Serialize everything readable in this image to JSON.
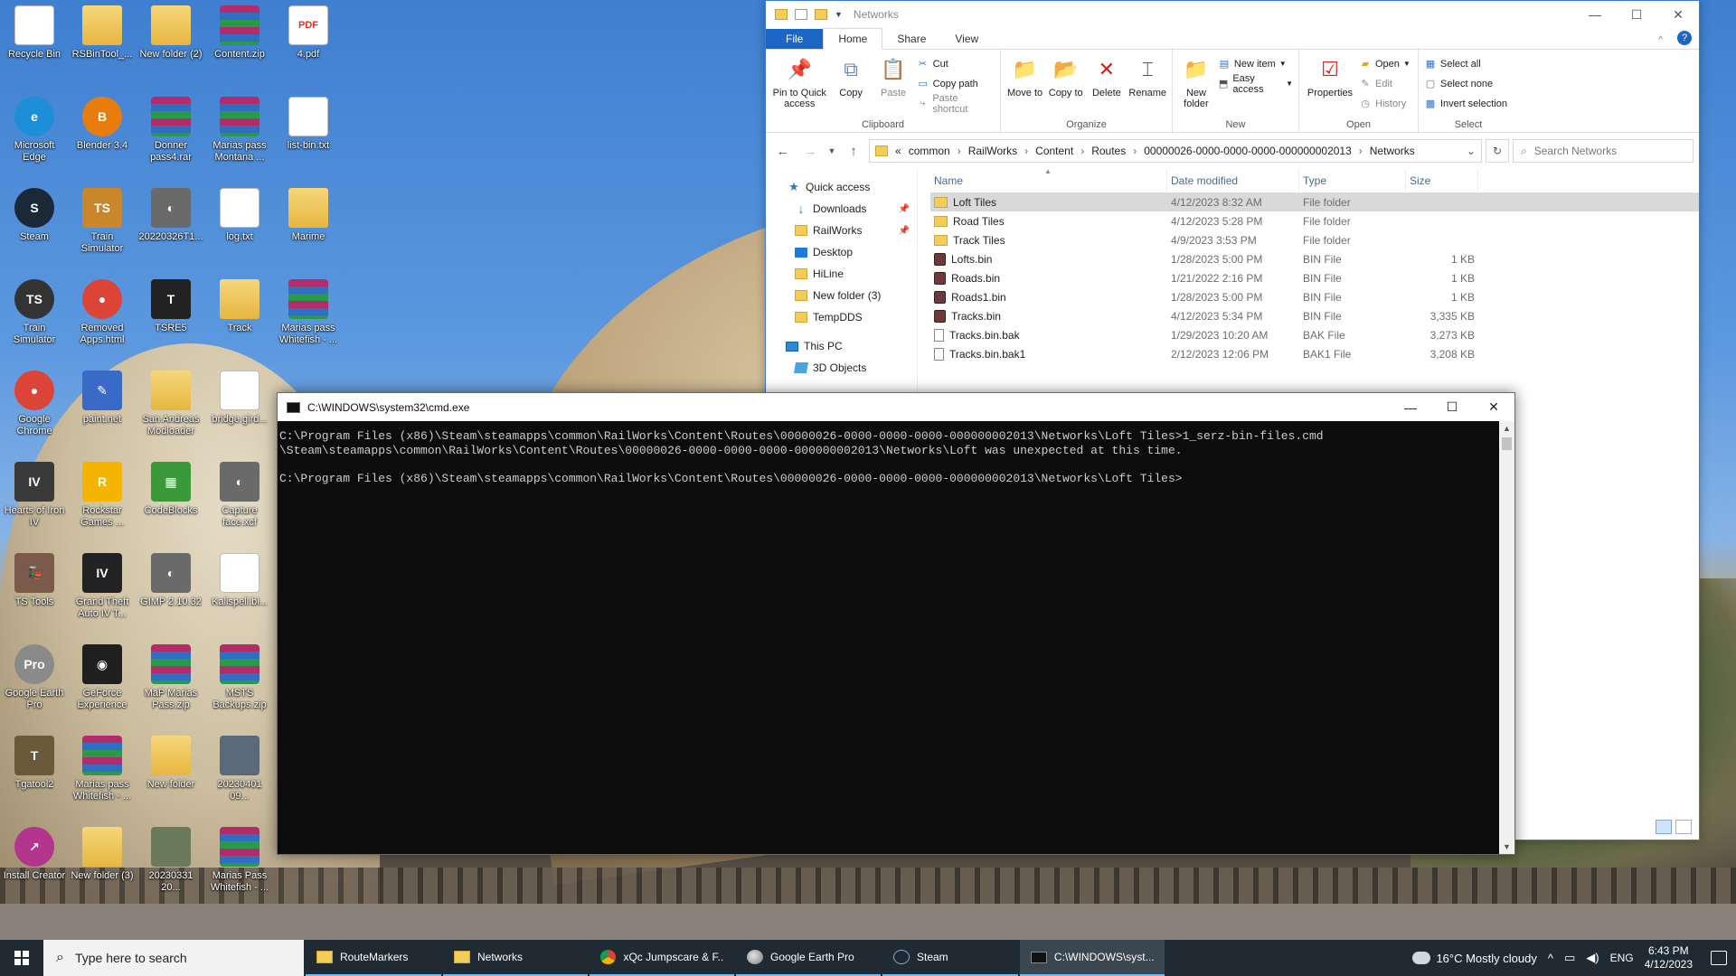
{
  "desktop": {
    "icons": [
      {
        "label": "Recycle Bin",
        "kind": "file",
        "glyph": "♻"
      },
      {
        "label": "Microsoft Edge",
        "kind": "round",
        "color": "#1d8fd8",
        "glyph": "e"
      },
      {
        "label": "Steam",
        "kind": "round",
        "color": "#1b2838",
        "glyph": "S"
      },
      {
        "label": "Train Simulator",
        "kind": "round",
        "color": "#333333",
        "glyph": "TS"
      },
      {
        "label": "Google Chrome",
        "kind": "round",
        "color": "#db4437",
        "glyph": "●"
      },
      {
        "label": "Hearts of Iron IV",
        "kind": "plain",
        "color": "#3a3a3a",
        "glyph": "IV"
      },
      {
        "label": "TS Tools",
        "kind": "plain",
        "color": "#7a5a4a",
        "glyph": "🚂"
      },
      {
        "label": "Google Earth Pro",
        "kind": "round",
        "color": "#8a8a8a",
        "glyph": "Pro"
      },
      {
        "label": "Tgatool2",
        "kind": "plain",
        "color": "#6a5a3a",
        "glyph": "T"
      },
      {
        "label": "Install Creator",
        "kind": "round",
        "color": "#b4358c",
        "glyph": "↗"
      },
      {
        "label": "RSBinTool_...",
        "kind": "folder",
        "glyph": ""
      },
      {
        "label": "Blender 3.4",
        "kind": "round",
        "color": "#e87d0d",
        "glyph": "B"
      },
      {
        "label": "Train Simulator",
        "kind": "plain",
        "color": "#c9862a",
        "glyph": "TS"
      },
      {
        "label": "Removed Apps.html",
        "kind": "round",
        "color": "#db4437",
        "glyph": "●"
      },
      {
        "label": "paint.net",
        "kind": "plain",
        "color": "#3a6ac8",
        "glyph": "✎"
      },
      {
        "label": "Rockstar Games ...",
        "kind": "plain",
        "color": "#f4b400",
        "glyph": "R"
      },
      {
        "label": "Grand Theft Auto IV T...",
        "kind": "plain",
        "color": "#222222",
        "glyph": "IV"
      },
      {
        "label": "GeForce Experience",
        "kind": "plain",
        "color": "#1f1f1f",
        "glyph": "◉"
      },
      {
        "label": "Marias pass Whitefish - ...",
        "kind": "rar",
        "glyph": ""
      },
      {
        "label": "New folder (3)",
        "kind": "folder",
        "glyph": ""
      },
      {
        "label": "New folder (2)",
        "kind": "folder",
        "glyph": ""
      },
      {
        "label": "Donner pass4.rar",
        "kind": "rar",
        "glyph": ""
      },
      {
        "label": "20220326T1...",
        "kind": "plain",
        "color": "#6a6a6a",
        "glyph": "◐"
      },
      {
        "label": "TSRE5",
        "kind": "plain",
        "color": "#222222",
        "glyph": "T"
      },
      {
        "label": "San Andreas Modloader",
        "kind": "folder",
        "glyph": ""
      },
      {
        "label": "CodeBlocks",
        "kind": "plain",
        "color": "#3a9a3a",
        "glyph": "▦"
      },
      {
        "label": "GIMP 2.10.32",
        "kind": "plain",
        "color": "#6a6a6a",
        "glyph": "◐"
      },
      {
        "label": "MaP Marias Pass.zip",
        "kind": "rar",
        "glyph": ""
      },
      {
        "label": "New folder",
        "kind": "folder",
        "glyph": ""
      },
      {
        "label": "20230331 20...",
        "kind": "plain",
        "color": "#6b7a5a",
        "glyph": ""
      },
      {
        "label": "Content.zip",
        "kind": "rar",
        "glyph": ""
      },
      {
        "label": "Marias pass Montana ...",
        "kind": "rar",
        "glyph": ""
      },
      {
        "label": "log.txt",
        "kind": "file",
        "glyph": ""
      },
      {
        "label": "Track",
        "kind": "folder",
        "glyph": ""
      },
      {
        "label": "bridge.gird...",
        "kind": "file",
        "glyph": ""
      },
      {
        "label": "Capture face.xcf",
        "kind": "plain",
        "color": "#6a6a6a",
        "glyph": "◐"
      },
      {
        "label": "Kalispell.bi...",
        "kind": "file",
        "glyph": ""
      },
      {
        "label": "MSTS Backups.zip",
        "kind": "rar",
        "glyph": ""
      },
      {
        "label": "20230401 09...",
        "kind": "plain",
        "color": "#5a6a7a",
        "glyph": ""
      },
      {
        "label": "Marias Pass Whitefish - ...",
        "kind": "rar",
        "glyph": ""
      },
      {
        "label": "4.pdf",
        "kind": "pdf",
        "glyph": "PDF"
      },
      {
        "label": "list-bin.txt",
        "kind": "file",
        "glyph": ""
      },
      {
        "label": "Marime",
        "kind": "folder",
        "glyph": ""
      },
      {
        "label": "Marias pass Whitefish - ...",
        "kind": "rar",
        "glyph": ""
      }
    ]
  },
  "explorer": {
    "title": "Networks",
    "tabs": [
      "File",
      "Home",
      "Share",
      "View"
    ],
    "ribbon": {
      "clipboard": {
        "name": "Clipboard",
        "pin": "Pin to Quick access",
        "copy": "Copy",
        "paste": "Paste",
        "cut": "Cut",
        "copy_path": "Copy path",
        "paste_shortcut": "Paste shortcut"
      },
      "organize": {
        "name": "Organize",
        "move_to": "Move to",
        "copy_to": "Copy to",
        "delete": "Delete",
        "rename": "Rename"
      },
      "new": {
        "name": "New",
        "new_folder": "New folder",
        "new_item": "New item",
        "easy_access": "Easy access"
      },
      "open": {
        "name": "Open",
        "properties": "Properties",
        "open": "Open",
        "edit": "Edit",
        "history": "History"
      },
      "select": {
        "name": "Select",
        "select_all": "Select all",
        "select_none": "Select none",
        "invert": "Invert selection"
      }
    },
    "address": [
      "«",
      "common",
      "RailWorks",
      "Content",
      "Routes",
      "00000026-0000-0000-0000-000000002013",
      "Networks"
    ],
    "search_placeholder": "Search Networks",
    "nav": {
      "quick_access": "Quick access",
      "downloads": "Downloads",
      "railworks": "RailWorks",
      "desktop": "Desktop",
      "hiline": "HiLine",
      "new_folder_3": "New folder (3)",
      "tempdds": "TempDDS",
      "this_pc": "This PC",
      "objects_3d": "3D Objects"
    },
    "columns": {
      "name": "Name",
      "date": "Date modified",
      "type": "Type",
      "size": "Size"
    },
    "files": [
      {
        "name": "Loft Tiles",
        "date": "4/12/2023 8:32 AM",
        "type": "File folder",
        "size": "",
        "icon": "folder"
      },
      {
        "name": "Road Tiles",
        "date": "4/12/2023 5:28 PM",
        "type": "File folder",
        "size": "",
        "icon": "folder"
      },
      {
        "name": "Track Tiles",
        "date": "4/9/2023 3:53 PM",
        "type": "File folder",
        "size": "",
        "icon": "folder"
      },
      {
        "name": "Lofts.bin",
        "date": "1/28/2023 5:00 PM",
        "type": "BIN File",
        "size": "1 KB",
        "icon": "bin"
      },
      {
        "name": "Roads.bin",
        "date": "1/21/2022 2:16 PM",
        "type": "BIN File",
        "size": "1 KB",
        "icon": "bin"
      },
      {
        "name": "Roads1.bin",
        "date": "1/28/2023 5:00 PM",
        "type": "BIN File",
        "size": "1 KB",
        "icon": "bin"
      },
      {
        "name": "Tracks.bin",
        "date": "4/12/2023 5:34 PM",
        "type": "BIN File",
        "size": "3,335 KB",
        "icon": "bin"
      },
      {
        "name": "Tracks.bin.bak",
        "date": "1/29/2023 10:20 AM",
        "type": "BAK File",
        "size": "3,273 KB",
        "icon": "bak"
      },
      {
        "name": "Tracks.bin.bak1",
        "date": "2/12/2023 12:06 PM",
        "type": "BAK1 File",
        "size": "3,208 KB",
        "icon": "bak"
      }
    ]
  },
  "cmd": {
    "title": "C:\\WINDOWS\\system32\\cmd.exe",
    "lines": [
      "C:\\Program Files (x86)\\Steam\\steamapps\\common\\RailWorks\\Content\\Routes\\00000026-0000-0000-0000-000000002013\\Networks\\Loft Tiles>1_serz-bin-files.cmd",
      "\\Steam\\steamapps\\common\\RailWorks\\Content\\Routes\\00000026-0000-0000-0000-000000002013\\Networks\\Loft was unexpected at this time.",
      "",
      "C:\\Program Files (x86)\\Steam\\steamapps\\common\\RailWorks\\Content\\Routes\\00000026-0000-0000-0000-000000002013\\Networks\\Loft Tiles>"
    ]
  },
  "taskbar": {
    "search_placeholder": "Type here to search",
    "apps": [
      {
        "label": "RouteMarkers",
        "icon": "fold",
        "active": false
      },
      {
        "label": "Networks",
        "icon": "fold",
        "active": false
      },
      {
        "label": "xQc Jumpscare & F...",
        "icon": "chrome",
        "active": false
      },
      {
        "label": "Google Earth Pro",
        "icon": "earth",
        "active": false
      },
      {
        "label": "Steam",
        "icon": "steam",
        "active": false
      },
      {
        "label": "C:\\WINDOWS\\syst...",
        "icon": "cmd",
        "active": true
      }
    ],
    "weather": "16°C  Mostly cloudy",
    "lang": "ENG",
    "time": "6:43 PM",
    "date": "4/12/2023"
  }
}
